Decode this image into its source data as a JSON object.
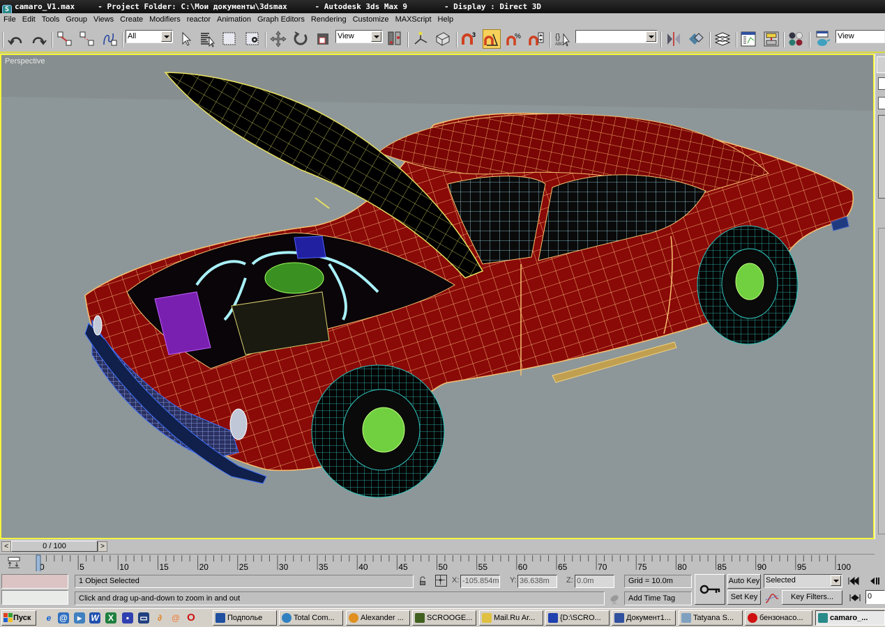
{
  "window": {
    "file": "camaro_V1.max",
    "project_folder": "- Project Folder: C:\\Мои документы\\3dsmax",
    "app": "- Autodesk 3ds Max 9",
    "display": "- Display : Direct 3D"
  },
  "menu": [
    "File",
    "Edit",
    "Tools",
    "Group",
    "Views",
    "Create",
    "Modifiers",
    "reactor",
    "Animation",
    "Graph Editors",
    "Rendering",
    "Customize",
    "MAXScript",
    "Help"
  ],
  "toolbar": {
    "selection_filter": "All",
    "reference_coord": "View",
    "named_selection": "",
    "right_view_combo": "View",
    "snap_count": "3",
    "icons": [
      "undo-icon",
      "redo-icon",
      "select-and-link-icon",
      "unlink-icon",
      "bind-space-warp-icon",
      "select-object-icon",
      "select-by-name-icon",
      "rectangular-selection-icon",
      "window-crossing-icon",
      "select-and-move-icon",
      "select-and-rotate-icon",
      "select-and-scale-icon",
      "use-pivot-center-icon",
      "select-manipulate-icon",
      "keyboard-shortcut-override-icon",
      "snaps-toggle-icon",
      "angle-snap-icon",
      "percent-snap-icon",
      "spinner-snap-icon",
      "edit-named-selection-icon",
      "mirror-icon",
      "align-icon",
      "layer-manager-icon",
      "curve-editor-icon",
      "schematic-view-icon",
      "material-editor-icon",
      "render-scene-icon"
    ]
  },
  "viewport": {
    "label": "Perspective",
    "background": "#878e8f",
    "border": "#f5f53c"
  },
  "timeline": {
    "frame_display": "0 / 100",
    "current_frame": 0,
    "total_frames": 100,
    "tick_labels": [
      "0",
      "5",
      "10",
      "15",
      "20",
      "25",
      "30",
      "35",
      "40",
      "45",
      "50",
      "55",
      "60",
      "65",
      "70",
      "75",
      "80",
      "85",
      "90",
      "95",
      "100"
    ]
  },
  "status": {
    "selection": "1 Object Selected",
    "prompt": "Click and drag up-and-down to zoom in and out",
    "x_label": "X:",
    "x": "-105.854m",
    "y_label": "Y:",
    "y": "36.638m",
    "z_label": "Z:",
    "z": "0.0m",
    "grid": "Grid = 10.0m",
    "add_time_tag": "Add Time Tag",
    "auto_key": "Auto Key",
    "set_key": "Set Key",
    "key_mode": "Selected",
    "key_filters": "Key Filters...",
    "frame_field": "0"
  },
  "taskbar": {
    "start": "Пуск",
    "tasks": [
      {
        "label": "Подполье",
        "color": "#2050a0"
      },
      {
        "label": "Total Com...",
        "color": "#3080c0"
      },
      {
        "label": "Alexander ...",
        "color": "#e09020"
      },
      {
        "label": "SCROOGE...",
        "color": "#406020"
      },
      {
        "label": "Mail.Ru Ar...",
        "color": "#e0c040"
      },
      {
        "label": "{D:\\SCRO...",
        "color": "#2040b0"
      },
      {
        "label": "Документ1...",
        "color": "#3050a0"
      },
      {
        "label": "Tatyana S...",
        "color": "#80a0c0"
      },
      {
        "label": "бензонасо...",
        "color": "#d01010"
      },
      {
        "label": "camaro_...",
        "color": "#2a8a8a"
      }
    ]
  }
}
